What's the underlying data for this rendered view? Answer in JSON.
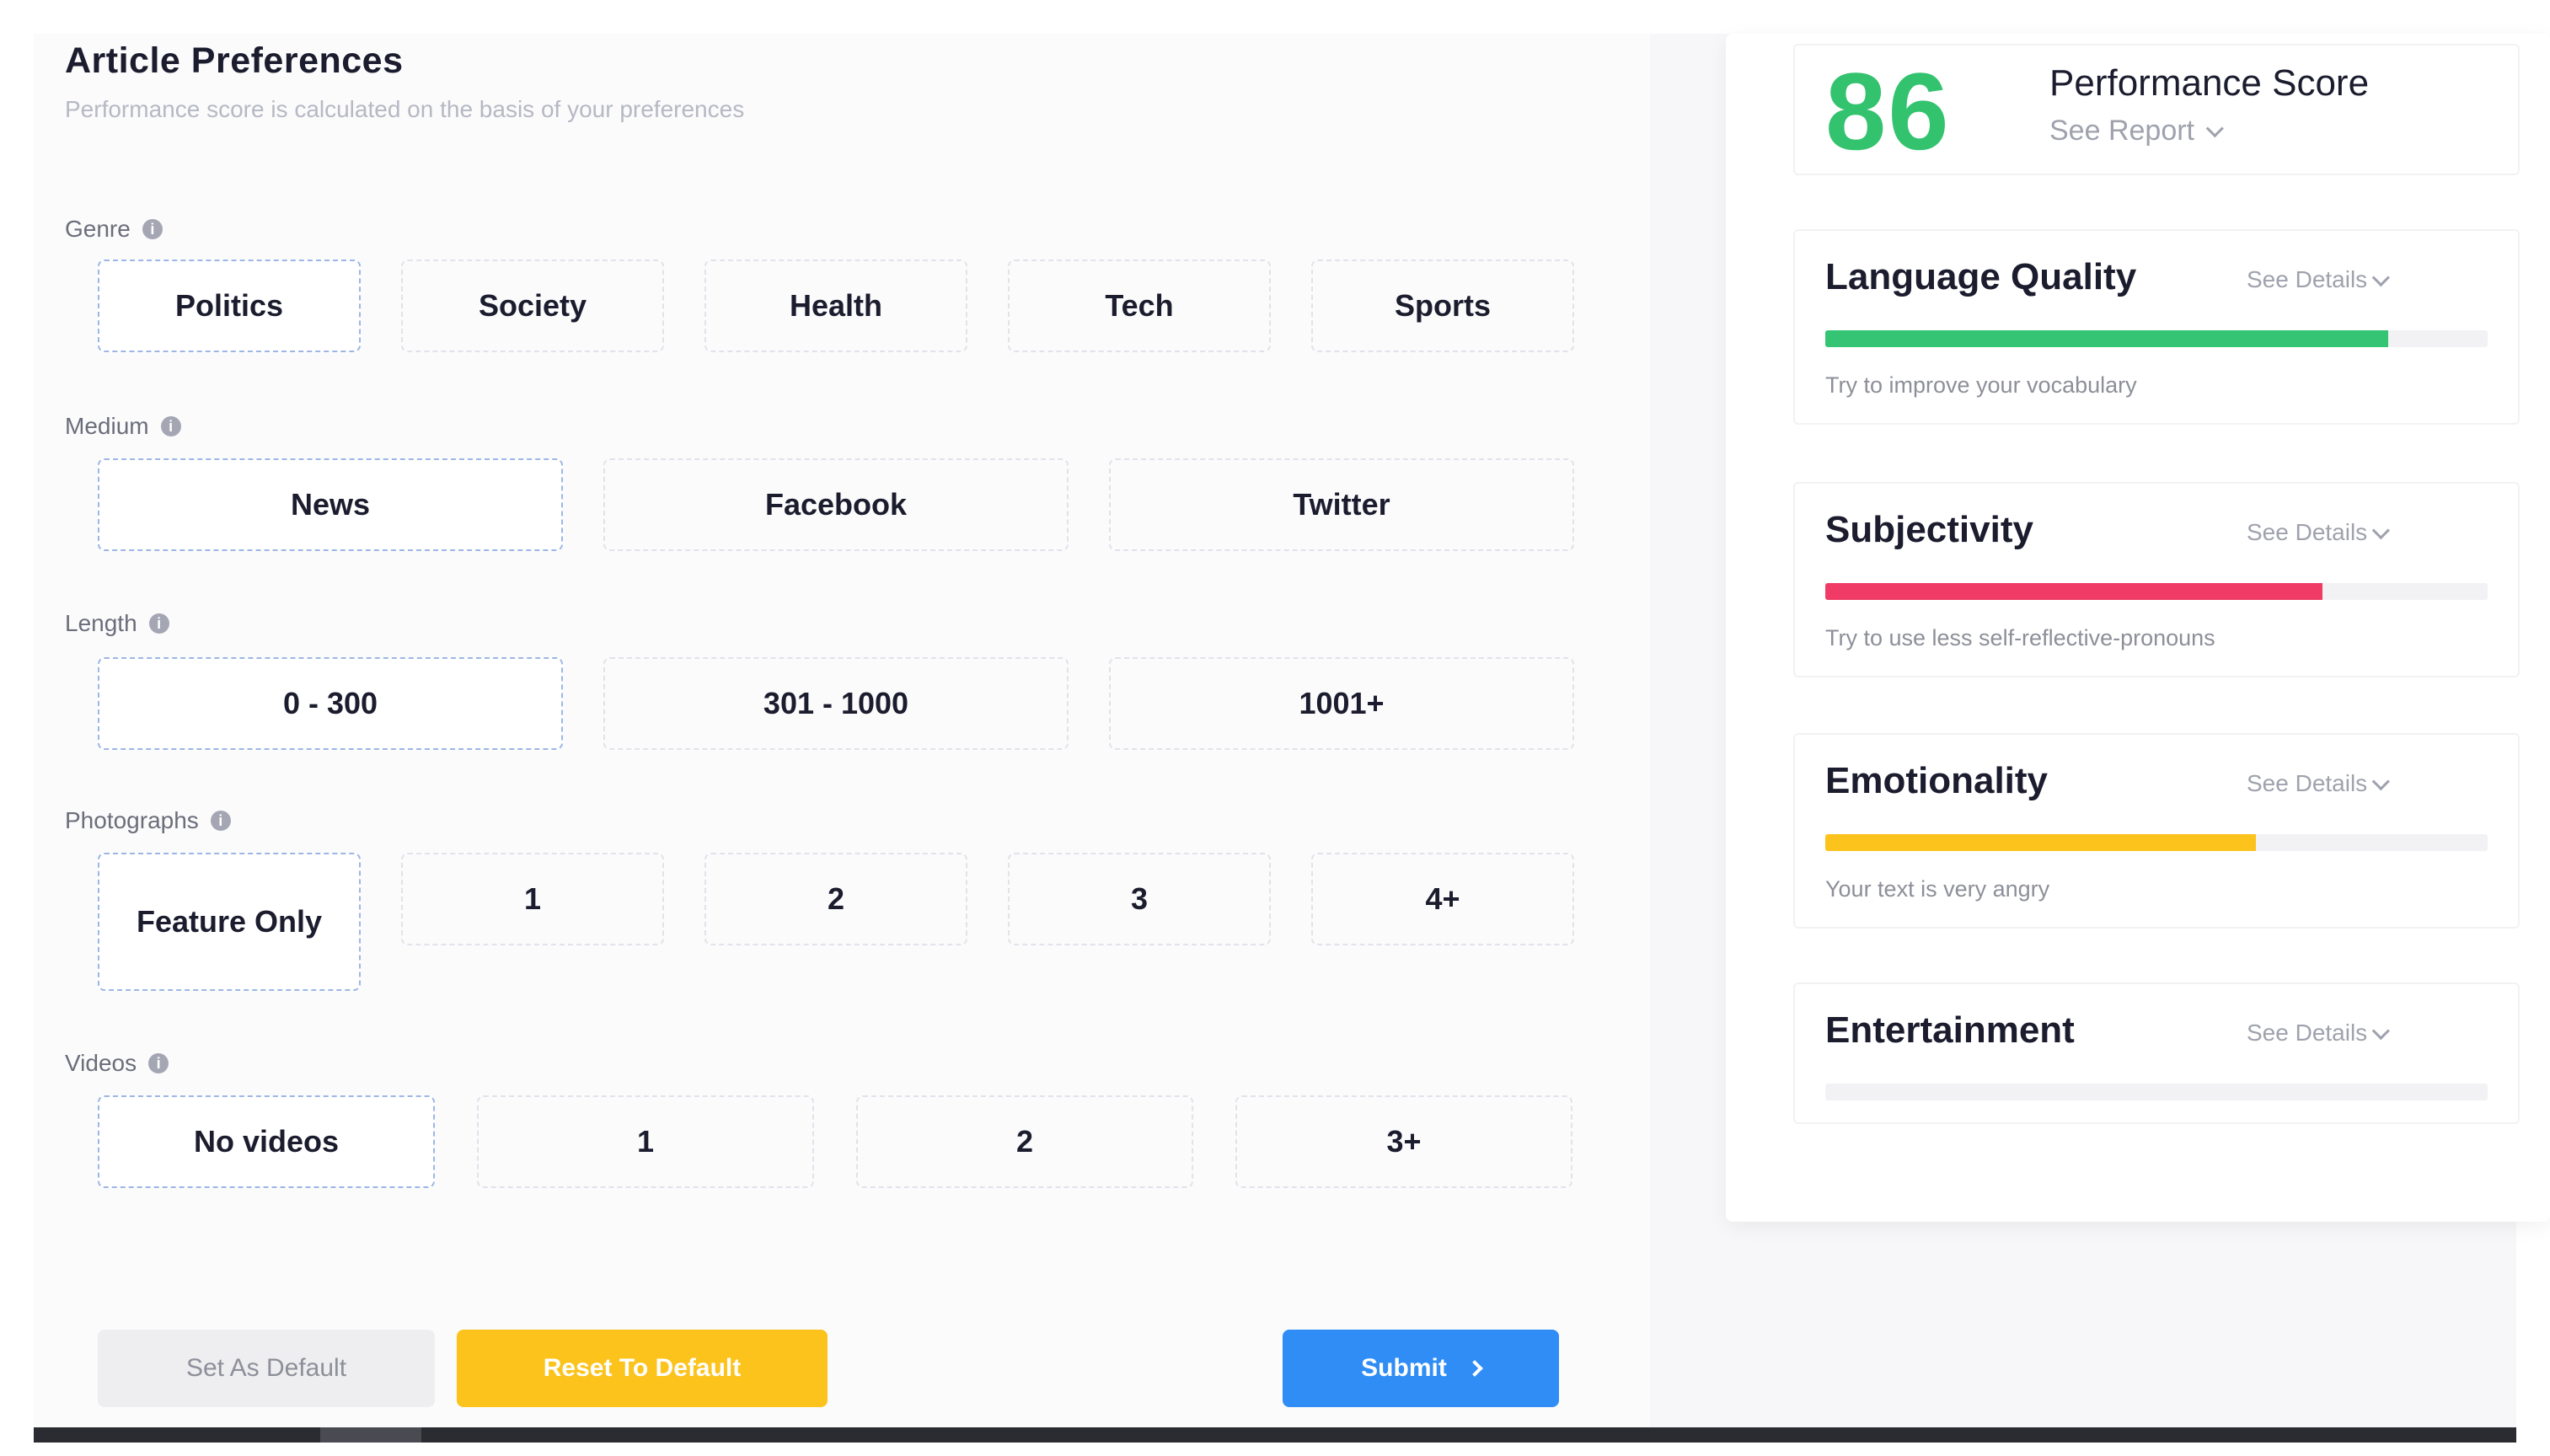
{
  "preferences": {
    "title": "Article Preferences",
    "subtitle": "Performance score is calculated on the basis of your preferences",
    "genre": {
      "label": "Genre",
      "options": [
        "Politics",
        "Society",
        "Health",
        "Tech",
        "Sports"
      ],
      "selected": "Politics"
    },
    "medium": {
      "label": "Medium",
      "options": [
        "News",
        "Facebook",
        "Twitter"
      ],
      "selected": "News"
    },
    "length": {
      "label": "Length",
      "options": [
        "0 - 300",
        "301 - 1000",
        "1001+"
      ],
      "selected": "0 - 300"
    },
    "photographs": {
      "label": "Photographs",
      "options": [
        "Feature Only",
        "1",
        "2",
        "3",
        "4+"
      ],
      "selected": "Feature Only"
    },
    "videos": {
      "label": "Videos",
      "options": [
        "No videos",
        "1",
        "2",
        "3+"
      ],
      "selected": "No videos"
    }
  },
  "actions": {
    "set_default": "Set As Default",
    "reset_default": "Reset To Default",
    "submit": "Submit"
  },
  "score": {
    "value": "86",
    "title": "Performance Score",
    "link": "See Report",
    "color": "#33c36f"
  },
  "metrics": [
    {
      "title": "Language Quality",
      "link": "See Details",
      "progress": 0.85,
      "color": "#34c473",
      "hint": "Try to improve your vocabulary"
    },
    {
      "title": "Subjectivity",
      "link": "See Details",
      "progress": 0.75,
      "color": "#ef3b66",
      "hint": "Try to use less self-reflective-pronouns"
    },
    {
      "title": "Emotionality",
      "link": "See Details",
      "progress": 0.65,
      "color": "#fbc31c",
      "hint": "Your text is very angry"
    },
    {
      "title": "Entertainment",
      "link": "See Details",
      "progress": 0,
      "color": "#cccccc",
      "hint": ""
    }
  ],
  "icons": {
    "info": "info-icon",
    "chevron": "chevron-down-icon",
    "arrow": "chevron-right-icon"
  },
  "colors": {
    "accent": "#2f8df5",
    "warning": "#fbc31c",
    "selected_border": "#9db6e6"
  }
}
